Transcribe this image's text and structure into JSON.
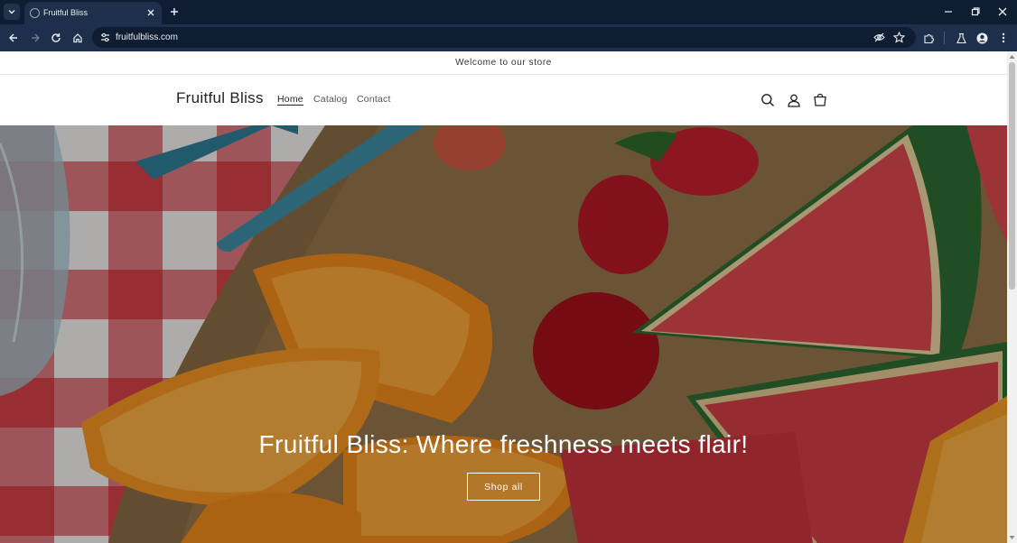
{
  "browser": {
    "tab": {
      "title": "Fruitful Bliss",
      "favicon": "globe-icon"
    },
    "url": "fruitfulbliss.com",
    "icons": {
      "tab_list": "chevron-down-icon",
      "tab_close": "close-icon",
      "new_tab": "plus-icon",
      "minimize": "minimize-icon",
      "restore": "restore-icon",
      "close_window": "close-icon",
      "back": "back-arrow-icon",
      "forward": "forward-arrow-icon",
      "reload": "reload-icon",
      "home": "home-icon",
      "site_info": "tune-icon",
      "tracking": "eye-off-icon",
      "bookmark": "star-icon",
      "extensions": "puzzle-icon",
      "labs": "flask-icon",
      "profile": "profile-icon",
      "menu": "kebab-menu-icon"
    },
    "colors": {
      "tabstrip": "#0f1d33",
      "toolbar": "#1e2f4b"
    }
  },
  "store": {
    "announcement": "Welcome to our store",
    "logo": "Fruitful Bliss",
    "nav": [
      {
        "label": "Home",
        "active": true
      },
      {
        "label": "Catalog",
        "active": false
      },
      {
        "label": "Contact",
        "active": false
      }
    ],
    "header_icons": [
      "search-icon",
      "account-icon",
      "cart-icon"
    ],
    "hero": {
      "title": "Fruitful Bliss: Where freshness meets flair!",
      "button": "Shop all"
    }
  }
}
